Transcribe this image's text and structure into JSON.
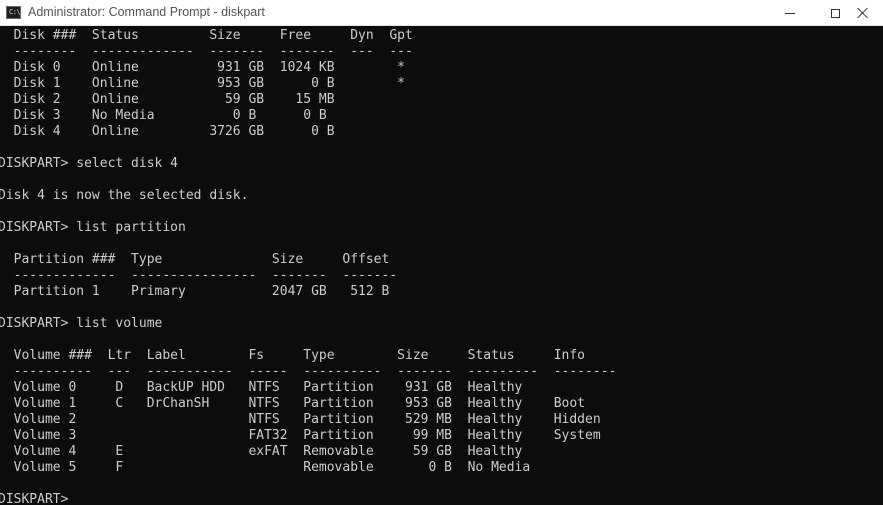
{
  "window": {
    "title": "Administrator: Command Prompt - diskpart",
    "icon": "cmd-icon",
    "icon_glyph": "C:\\"
  },
  "console": {
    "lines": [
      "  Disk ###  Status         Size     Free     Dyn  Gpt",
      "  --------  -------------  -------  -------  ---  ---",
      "  Disk 0    Online          931 GB  1024 KB        *",
      "  Disk 1    Online          953 GB      0 B        *",
      "  Disk 2    Online           59 GB    15 MB",
      "  Disk 3    No Media          0 B      0 B",
      "  Disk 4    Online         3726 GB      0 B",
      "",
      "DISKPART> select disk 4",
      "",
      "Disk 4 is now the selected disk.",
      "",
      "DISKPART> list partition",
      "",
      "  Partition ###  Type              Size     Offset",
      "  -------------  ----------------  -------  -------",
      "  Partition 1    Primary           2047 GB   512 B",
      "",
      "DISKPART> list volume",
      "",
      "  Volume ###  Ltr  Label        Fs     Type        Size     Status     Info",
      "  ----------  ---  -----------  -----  ----------  -------  ---------  --------",
      "  Volume 0     D   BackUP HDD   NTFS   Partition    931 GB  Healthy",
      "  Volume 1     C   DrChanSH     NTFS   Partition    953 GB  Healthy    Boot",
      "  Volume 2                      NTFS   Partition    529 MB  Healthy    Hidden",
      "  Volume 3                      FAT32  Partition     99 MB  Healthy    System",
      "  Volume 4     E                exFAT  Removable     59 GB  Healthy",
      "  Volume 5     F                       Removable       0 B  No Media",
      "",
      "DISKPART> "
    ]
  }
}
